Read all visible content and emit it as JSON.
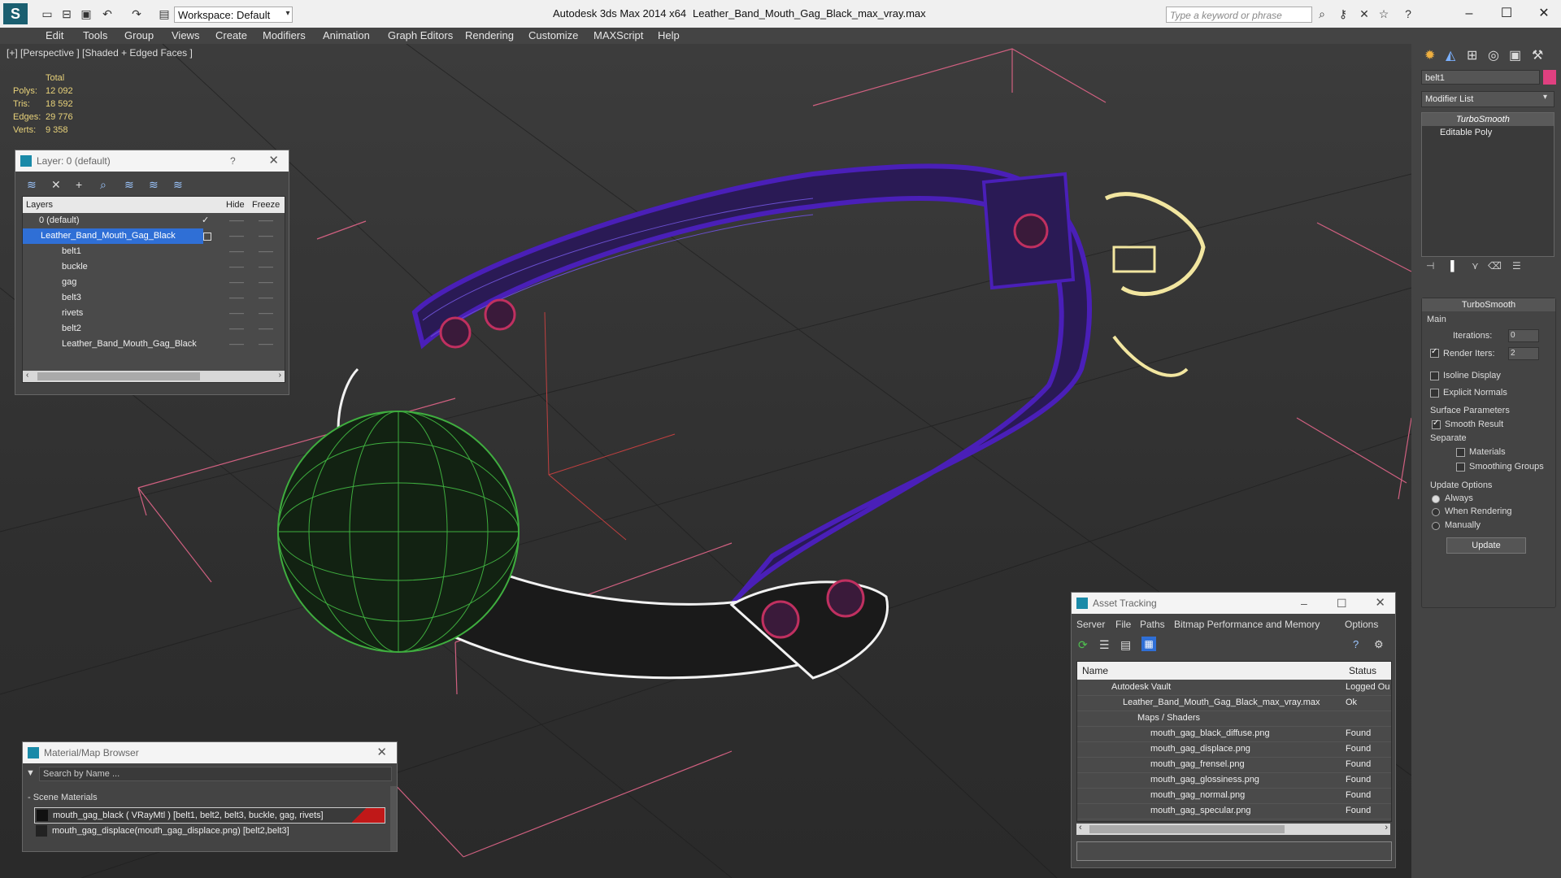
{
  "titlebar": {
    "app_title": "Autodesk 3ds Max  2014 x64",
    "file_title": "Leather_Band_Mouth_Gag_Black_max_vray.max",
    "workspace": "Workspace: Default",
    "search_placeholder": "Type a keyword or phrase"
  },
  "menu": [
    "Edit",
    "Tools",
    "Group",
    "Views",
    "Create",
    "Modifiers",
    "Animation",
    "Graph Editors",
    "Rendering",
    "Customize",
    "MAXScript",
    "Help"
  ],
  "viewport": {
    "label": "[+] [Perspective ] [Shaded + Edged Faces ]",
    "stats": {
      "header": "Total",
      "rows": [
        {
          "label": "Polys:",
          "value": "12 092"
        },
        {
          "label": "Tris:",
          "value": "18 592"
        },
        {
          "label": "Edges:",
          "value": "29 776"
        },
        {
          "label": "Verts:",
          "value": "9 358"
        }
      ]
    }
  },
  "layer_panel": {
    "title": "Layer: 0 (default)",
    "help": "?",
    "columns": {
      "layers": "Layers",
      "hide": "Hide",
      "freeze": "Freeze"
    },
    "rows": [
      {
        "name": "0 (default)",
        "level": 0
      },
      {
        "name": "Leather_Band_Mouth_Gag_Black",
        "level": 0,
        "selected": true
      },
      {
        "name": "belt1",
        "level": 1
      },
      {
        "name": "buckle",
        "level": 1
      },
      {
        "name": "gag",
        "level": 1
      },
      {
        "name": "belt3",
        "level": 1
      },
      {
        "name": "rivets",
        "level": 1
      },
      {
        "name": "belt2",
        "level": 1
      },
      {
        "name": "Leather_Band_Mouth_Gag_Black",
        "level": 1
      }
    ]
  },
  "command_panel": {
    "object_name": "belt1",
    "modifier_list": "Modifier List",
    "stack": [
      "TurboSmooth",
      "Editable Poly"
    ],
    "turbosmooth": {
      "title": "TurboSmooth",
      "main": "Main",
      "iterations_label": "Iterations:",
      "iterations": "0",
      "render_iters_label": "Render Iters:",
      "render_iters": "2",
      "isoline": "Isoline Display",
      "explicit_normals": "Explicit Normals",
      "surface_params": "Surface Parameters",
      "smooth_result": "Smooth Result",
      "separate": "Separate",
      "materials": "Materials",
      "smoothing_groups": "Smoothing Groups",
      "update_options": "Update Options",
      "always": "Always",
      "when_rendering": "When Rendering",
      "manually": "Manually",
      "update_button": "Update"
    }
  },
  "asset_tracking": {
    "title": "Asset Tracking",
    "menu": [
      "Server",
      "File",
      "Paths",
      "Bitmap Performance and Memory",
      "Options"
    ],
    "columns": {
      "name": "Name",
      "status": "Status"
    },
    "rows": [
      {
        "name": "Autodesk Vault",
        "status": "Logged Ou",
        "indent": 0
      },
      {
        "name": "Leather_Band_Mouth_Gag_Black_max_vray.max",
        "status": "Ok",
        "indent": 1
      },
      {
        "name": "Maps / Shaders",
        "status": "",
        "indent": 2
      },
      {
        "name": "mouth_gag_black_diffuse.png",
        "status": "Found",
        "indent": 3
      },
      {
        "name": "mouth_gag_displace.png",
        "status": "Found",
        "indent": 3
      },
      {
        "name": "mouth_gag_frensel.png",
        "status": "Found",
        "indent": 3
      },
      {
        "name": "mouth_gag_glossiness.png",
        "status": "Found",
        "indent": 3
      },
      {
        "name": "mouth_gag_normal.png",
        "status": "Found",
        "indent": 3
      },
      {
        "name": "mouth_gag_specular.png",
        "status": "Found",
        "indent": 3
      }
    ]
  },
  "material_browser": {
    "title": "Material/Map Browser",
    "search_placeholder": "Search by Name ...",
    "group": "- Scene Materials",
    "rows": [
      "mouth_gag_black  ( VRayMtl ) [belt1, belt2, belt3, buckle, gag, rivets]",
      "mouth_gag_displace(mouth_gag_displace.png) [belt2,belt3]"
    ]
  },
  "colors": {
    "accent": "#2f6fd6",
    "wire_purple": "#4a1fb8",
    "wire_green": "#3fae3f",
    "wire_white": "#f2f2f2",
    "grid_pink": "#d06080",
    "rivet": "#c03060"
  }
}
